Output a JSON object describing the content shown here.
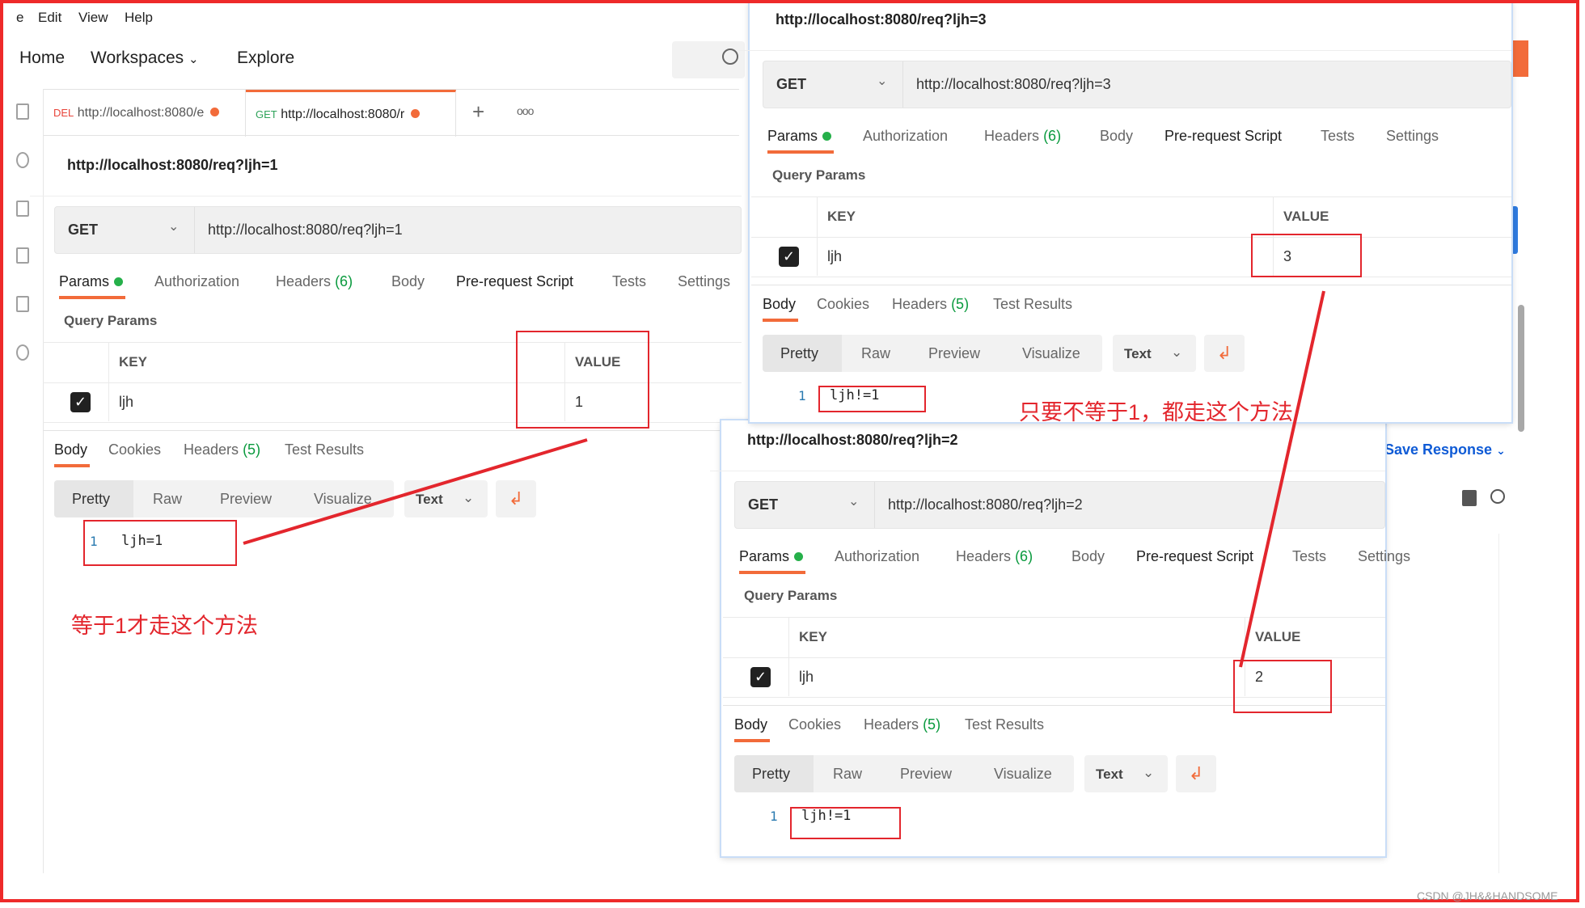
{
  "menu": [
    "e",
    "Edit",
    "View",
    "Help"
  ],
  "nav": {
    "home": "Home",
    "workspaces": "Workspaces",
    "explore": "Explore"
  },
  "tabs": [
    {
      "method": "DEL",
      "url": "http://localhost:8080/e",
      "method_color": "#e8443a"
    },
    {
      "method": "GET",
      "url": "http://localhost:8080/r",
      "method_color": "#2fa35a"
    }
  ],
  "new_tab": "+",
  "more_tabs": "ooo",
  "panels": [
    {
      "title": "http://localhost:8080/req?ljh=1",
      "method": "GET",
      "url": "http://localhost:8080/req?ljh=1",
      "key": "ljh",
      "value": "1",
      "response": "ljh=1"
    },
    {
      "title": "http://localhost:8080/req?ljh=2",
      "method": "GET",
      "url": "http://localhost:8080/req?ljh=2",
      "key": "ljh",
      "value": "2",
      "response": "ljh!=1"
    },
    {
      "title": "http://localhost:8080/req?ljh=3",
      "method": "GET",
      "url": "http://localhost:8080/req?ljh=3",
      "key": "ljh",
      "value": "3",
      "response": "ljh!=1"
    }
  ],
  "request_tabs": [
    {
      "label": "Params"
    },
    {
      "label": "Authorization"
    },
    {
      "label": "Headers",
      "count": "(6)"
    },
    {
      "label": "Body"
    },
    {
      "label": "Pre-request Script"
    },
    {
      "label": "Tests"
    },
    {
      "label": "Settings"
    }
  ],
  "query_params_label": "Query Params",
  "table_headers": {
    "key": "KEY",
    "value": "VALUE"
  },
  "response_tabs": [
    {
      "label": "Body"
    },
    {
      "label": "Cookies"
    },
    {
      "label": "Headers",
      "count": "(5)"
    },
    {
      "label": "Test Results"
    }
  ],
  "view_modes": [
    "Pretty",
    "Raw",
    "Preview",
    "Visualize"
  ],
  "format": "Text",
  "line_number": "1",
  "save_response": "Save Response",
  "annotations": {
    "equal": "等于1才走这个方法",
    "not_equal": "只要不等于1，都走这个方法"
  },
  "watermark": "CSDN @JH&&HANDSOME",
  "colors": {
    "accent": "#f26b3a",
    "annotation": "#e3262d",
    "link": "#0f5bd6"
  }
}
